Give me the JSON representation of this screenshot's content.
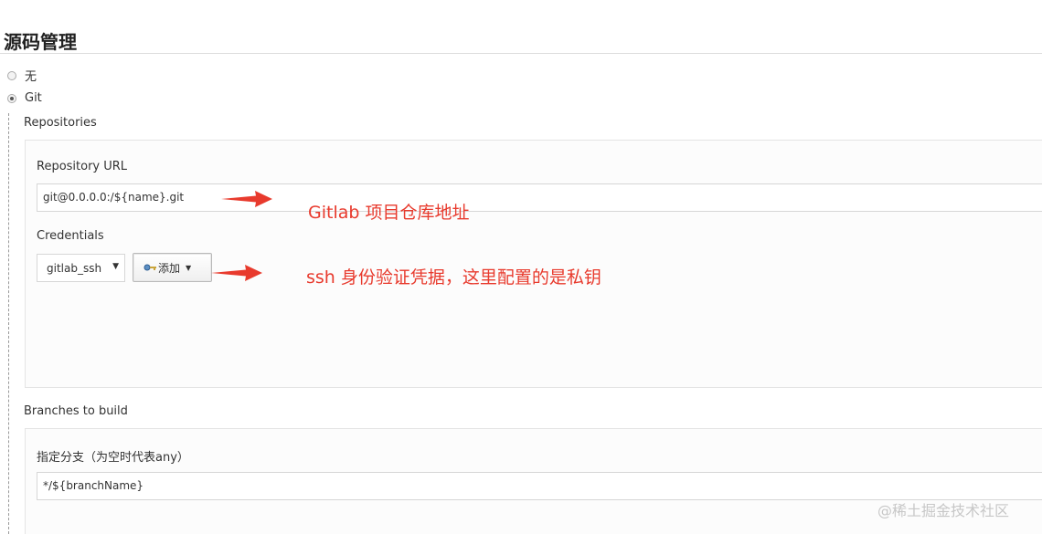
{
  "section": {
    "title": "源码管理"
  },
  "scm_options": [
    {
      "label": "无",
      "checked": false
    },
    {
      "label": "Git",
      "checked": true
    }
  ],
  "repositories": {
    "label": "Repositories",
    "url_label": "Repository URL",
    "url_value": "git@0.0.0.0:/${name}.git",
    "credentials_label": "Credentials",
    "credentials_selected": "gitlab_ssh",
    "add_button_label": "添加"
  },
  "branches": {
    "label": "Branches to build",
    "spec_label": "指定分支（为空时代表any）",
    "spec_value": "*/${branchName}"
  },
  "annotations": {
    "url_note": "Gitlab 项目仓库地址",
    "credentials_note": "ssh 身份验证凭据，这里配置的是私钥",
    "color": "#e83a2d"
  },
  "watermark": "@稀土掘金技术社区"
}
